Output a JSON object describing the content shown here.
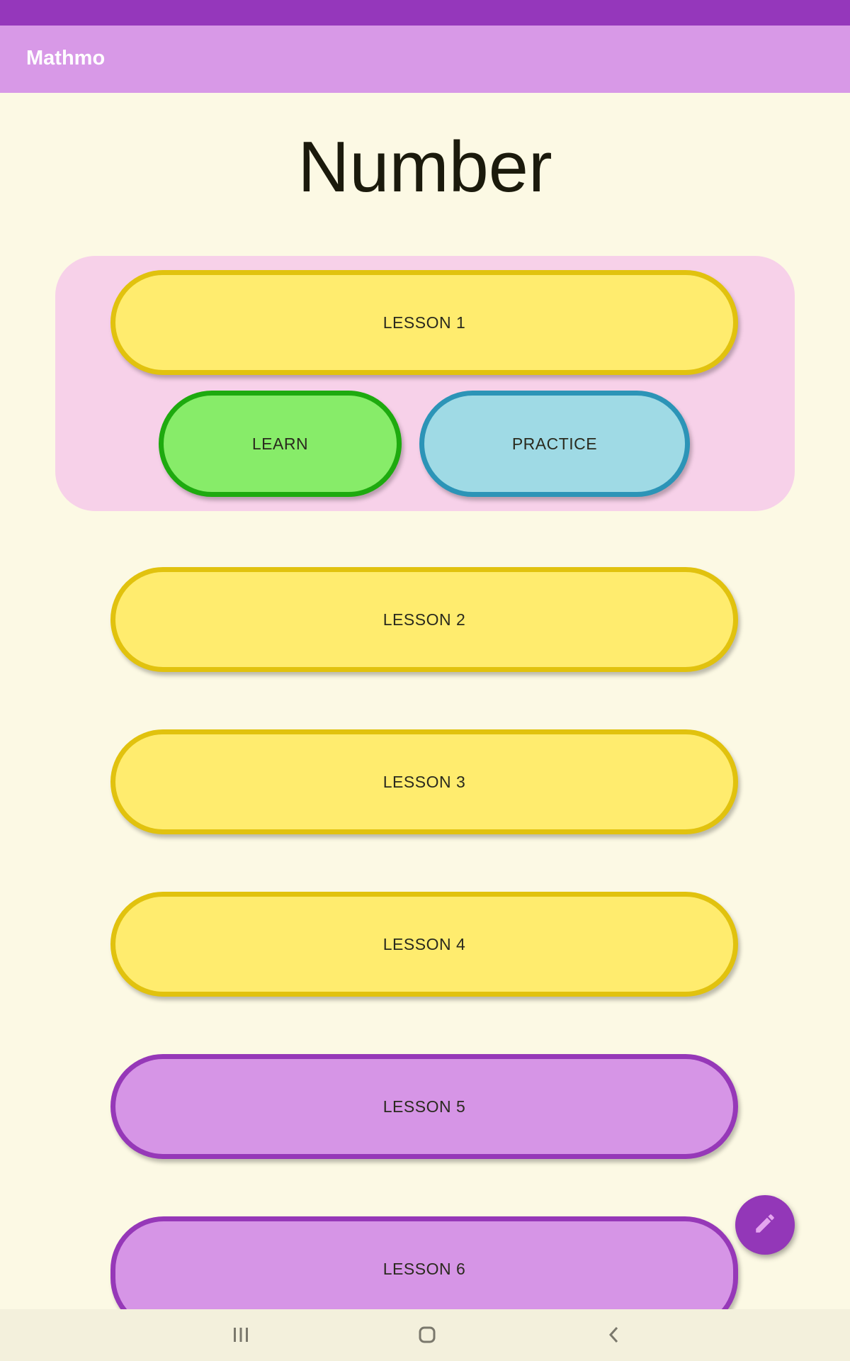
{
  "app": {
    "title": "Mathmo"
  },
  "page": {
    "title": "Number"
  },
  "lesson_panel": {
    "lesson_label": "LESSON 1",
    "learn_label": "LEARN",
    "practice_label": "PRACTICE"
  },
  "lessons": [
    {
      "label": "LESSON 2",
      "color": "#ffec6e"
    },
    {
      "label": "LESSON 3",
      "color": "#ffec6e"
    },
    {
      "label": "LESSON 4",
      "color": "#ffec6e"
    },
    {
      "label": "LESSON 5",
      "color": "#d695e6"
    },
    {
      "label": "LESSON 6",
      "color": "#d695e6"
    }
  ],
  "fab": {
    "icon": "pencil-icon"
  },
  "nav": {
    "icons": [
      "recent-apps-icon",
      "home-icon",
      "back-icon"
    ]
  },
  "colors": {
    "status_bar": "#9537bb",
    "app_bar": "#d899e7",
    "background": "#fcf9e4",
    "panel": "#f7d1e9",
    "lesson_yellow": "#ffec6e",
    "lesson_purple": "#d695e6",
    "learn_green": "#87ec69",
    "practice_blue": "#9fdae5",
    "fab": "#9337b8"
  }
}
